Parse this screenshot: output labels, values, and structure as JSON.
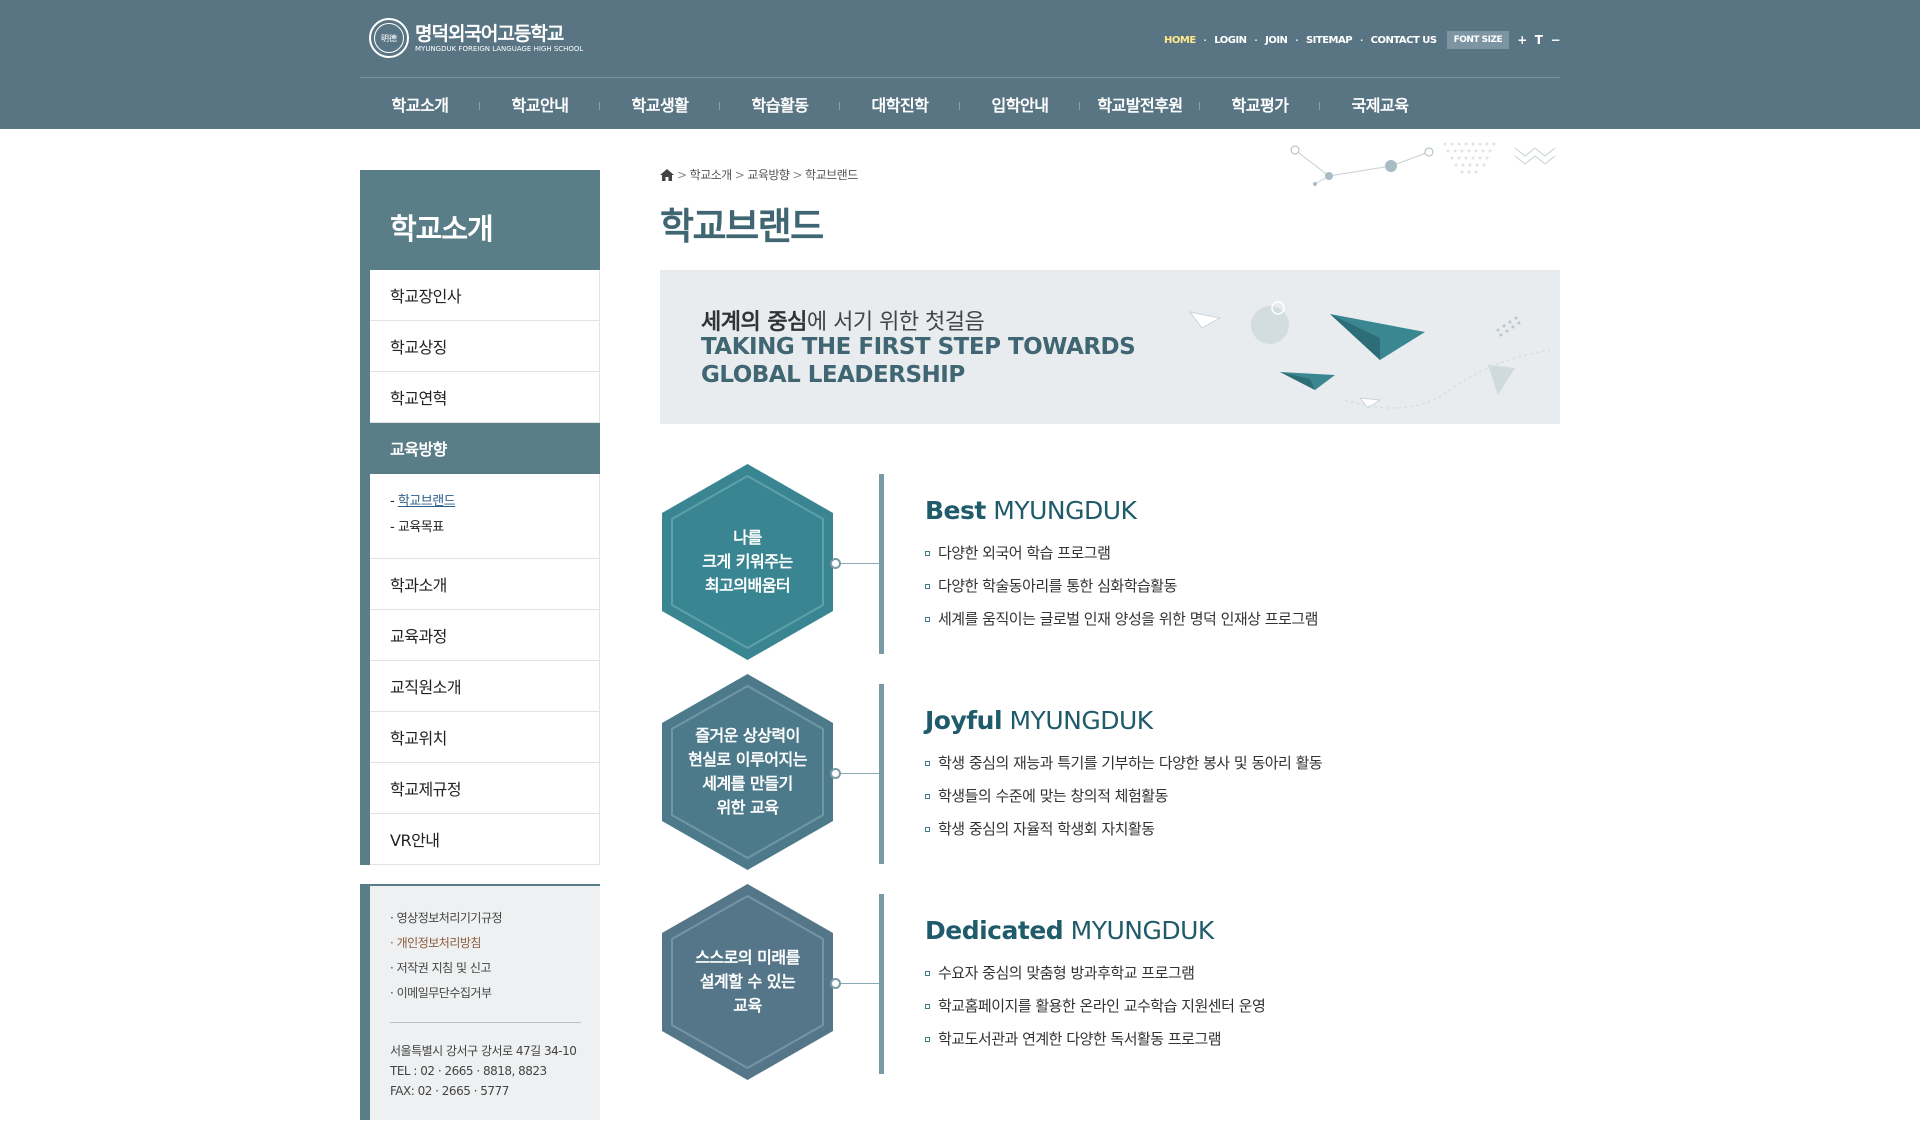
{
  "header": {
    "logo_ko": "명덕외국어고등학교",
    "logo_en": "MYUNGDUK FOREIGN LANGUAGE HIGH SCHOOL",
    "logo_emblem": "明德",
    "util": {
      "home": "HOME",
      "login": "LOGIN",
      "join": "JOIN",
      "sitemap": "SITEMAP",
      "contact": "CONTACT US",
      "font_size": "FONT SIZE",
      "plus": "+",
      "reset": "T",
      "minus": "−"
    },
    "gnb": [
      "학교소개",
      "학교안내",
      "학교생활",
      "학습활동",
      "대학진학",
      "입학안내",
      "학교발전후원",
      "학교평가",
      "국제교육"
    ]
  },
  "sidebar": {
    "title": "학교소개",
    "items": [
      "학교장인사",
      "학교상징",
      "학교연혁",
      "교육방향",
      "학과소개",
      "교육과정",
      "교직원소개",
      "학교위치",
      "학교제규정",
      "VR안내"
    ],
    "sub_items": [
      "학교브랜드",
      "교육목표"
    ],
    "info_links": [
      "영상정보처리기기규정",
      "개인정보처리방침",
      "저작권 지침 및 신고",
      "이메일무단수집거부"
    ],
    "address": "서울특별시 강서구 강서로 47길 34-10",
    "tel": "TEL : 02 · 2665 · 8818, 8823",
    "fax": "FAX: 02 · 2665 · 5777"
  },
  "breadcrumb": [
    "학교소개",
    "교육방향",
    "학교브랜드"
  ],
  "page_title": "학교브랜드",
  "banner": {
    "ko_bold": "세계의 중심",
    "ko_rest": "에 서기 위한 첫걸음",
    "en_line1": "TAKING THE FIRST STEP TOWARDS",
    "en_line2": "GLOBAL LEADERSHIP"
  },
  "sections": [
    {
      "hex_lines": [
        "나를",
        "크게 키워주는",
        "최고의배움터"
      ],
      "title_bold": "Best",
      "title_rest": " MYUNGDUK",
      "bullets": [
        "다양한 외국어 학습 프로그램",
        "다양한 학술동아리를 통한 심화학습활동",
        "세계를 움직이는 글로벌 인재 양성을 위한 명덕 인재상 프로그램"
      ],
      "color": "#3a8592"
    },
    {
      "hex_lines": [
        "즐거운 상상력이",
        "현실로 이루어지는",
        "세계를 만들기",
        "위한 교육"
      ],
      "title_bold": "Joyful",
      "title_rest": " MYUNGDUK",
      "bullets": [
        "학생 중심의 재능과 특기를 기부하는 다양한 봉사 및 동아리 활동",
        "학생들의 수준에 맞는 창의적 체험활동",
        "학생 중심의 자율적 학생회 자치활동"
      ],
      "color": "#4d7a8a"
    },
    {
      "hex_lines": [
        "스스로의 미래를",
        "설계할 수 있는",
        "교육"
      ],
      "title_bold": "Dedicated",
      "title_rest": " MYUNGDUK",
      "bullets": [
        "수요자 중심의 맞춤형 방과후학교 프로그램",
        "학교홈페이지를 활용한 온라인 교수학습 지원센터 운영",
        "학교도서관과 연계한 다양한 독서활동 프로그램"
      ],
      "color": "#557688"
    }
  ]
}
